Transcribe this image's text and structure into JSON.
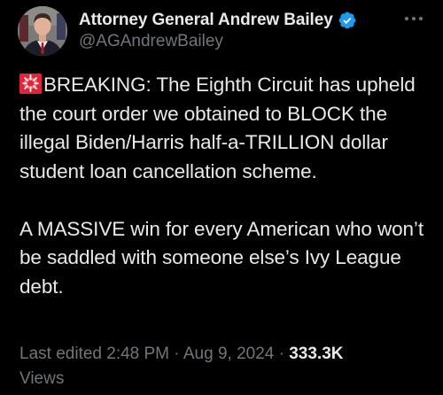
{
  "author": {
    "display_name": "Attorney General Andrew Bailey",
    "handle": "@AGAndrewBailey",
    "verified": true,
    "verified_color": "#1d9bf0"
  },
  "icons": {
    "verified": "verified-badge-icon",
    "more": "more-options-icon",
    "siren": "police-siren-emoji"
  },
  "tweet": {
    "paragraph_1": "BREAKING: The Eighth Circuit has upheld the court order we obtained to BLOCK the illegal Biden/Harris half-a-TRILLION dollar student loan cancellation scheme.",
    "paragraph_2": "A MASSIVE win for every American who won’t be saddled with someone else’s Ivy League debt."
  },
  "meta": {
    "edited_label": "Last edited",
    "time": "2:48 PM",
    "separator": "·",
    "date": "Aug 9, 2024",
    "views_count": "333.3K",
    "views_label": "Views"
  },
  "colors": {
    "background": "#000000",
    "primary_text": "#e7e9ea",
    "secondary_text": "#71767b",
    "siren_red": "#e0243a"
  }
}
